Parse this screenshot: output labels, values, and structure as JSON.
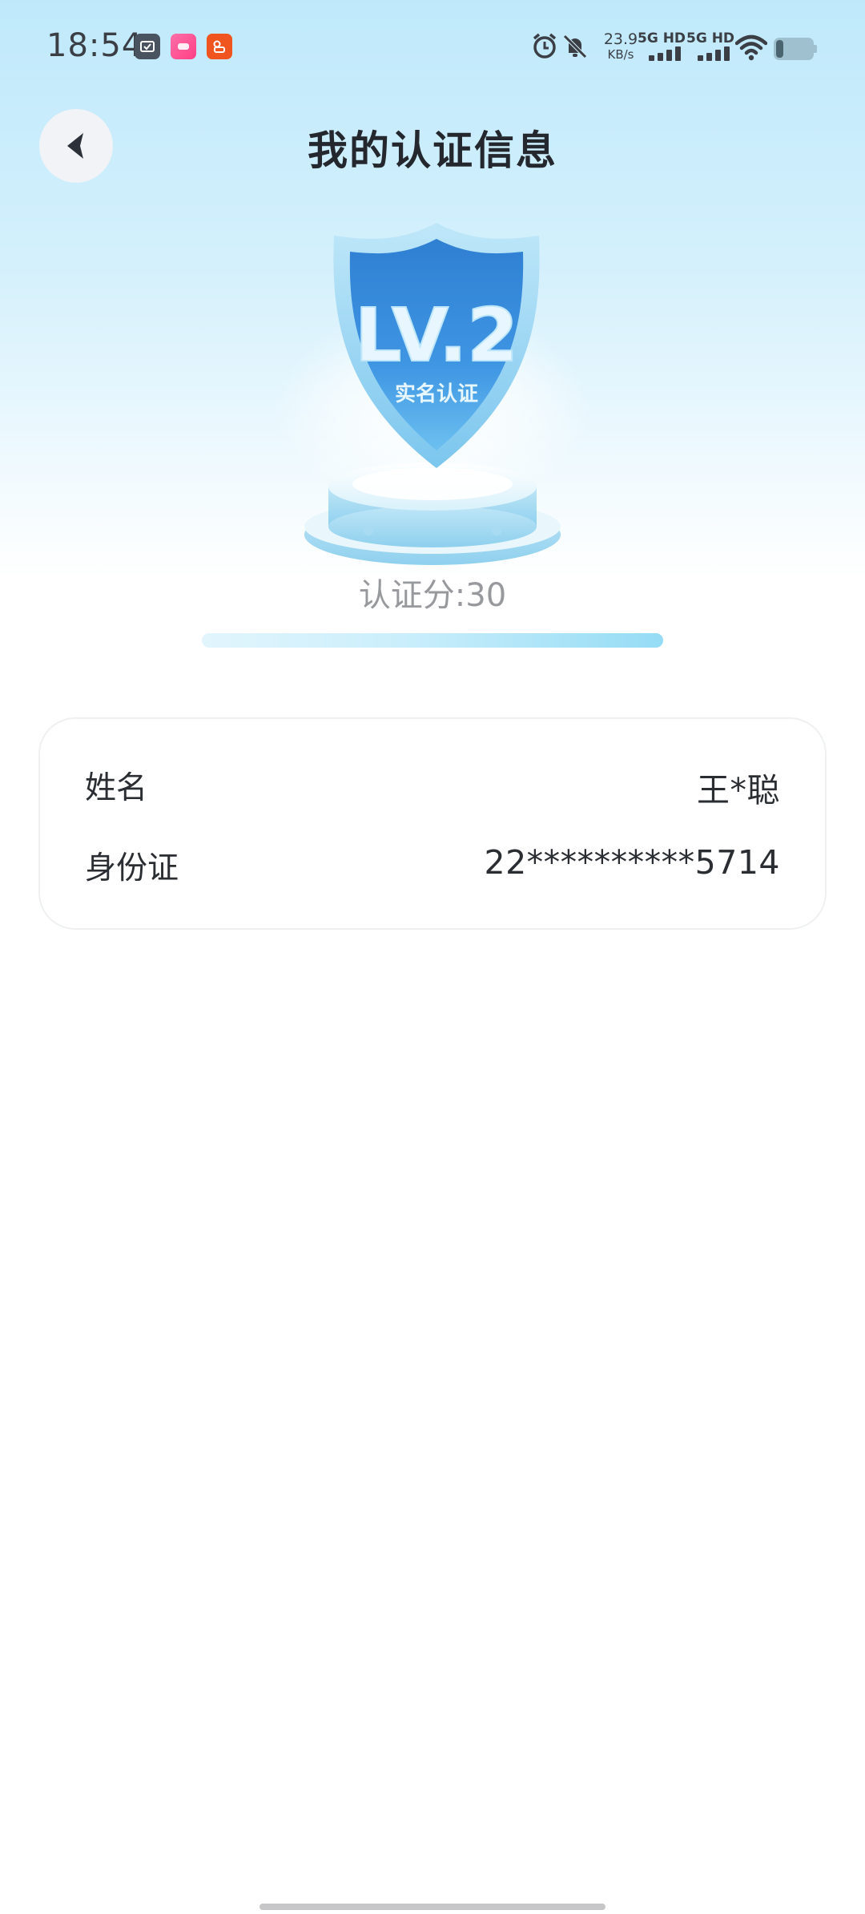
{
  "status_bar": {
    "time": "18:54",
    "net_speed_value": "23.9",
    "net_speed_unit": "KB/s",
    "signal_1_label": "5G HD",
    "signal_2_label": "5G HD",
    "battery_level": 0.2
  },
  "header": {
    "title": "我的认证信息"
  },
  "badge": {
    "level_text": "LV.2",
    "level_subtitle": "实名认证"
  },
  "score": {
    "label": "认证分:30"
  },
  "info": {
    "rows": [
      {
        "key": "姓名",
        "value": "王*聪"
      },
      {
        "key": "身份证",
        "value": "22**********5714"
      }
    ]
  },
  "colors": {
    "accent_blue": "#3a8ee0",
    "progress_end": "#95dcf5"
  }
}
